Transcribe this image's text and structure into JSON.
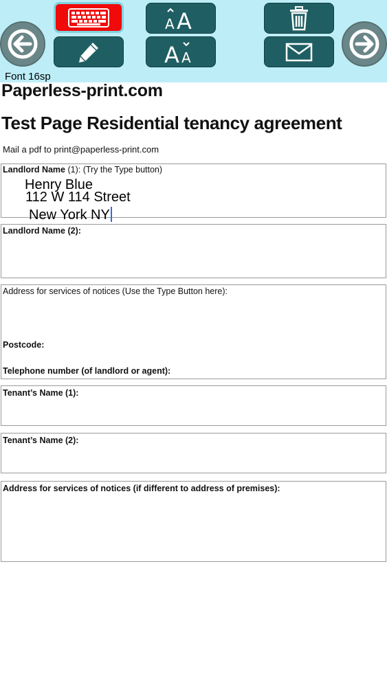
{
  "toolbar": {
    "font_label": "Font 16sp",
    "buttons": {
      "keyboard": "keyboard-icon",
      "font_larger": "ÂA",
      "delete": "trash-icon",
      "pen": "pencil-icon",
      "font_smaller": "AǍ",
      "mail": "envelope-icon"
    },
    "colors": {
      "bar": "#bdeef8",
      "button": "#1f5f63",
      "active_button": "#f00a0a",
      "nav": "#6b8688"
    }
  },
  "document": {
    "site": "Paperless-print.com",
    "heading": "Test Page Residential tenancy agreement",
    "mail_line": "Mail a pdf to print@paperless-print.com",
    "fields": {
      "landlord1_label_bold": "Landlord Name",
      "landlord1_label_rest": " (1): (Try the Type button)",
      "landlord1_typed": [
        "Henry Blue",
        "112 W 114 Street",
        "New York NY"
      ],
      "landlord2_label": "Landlord Name (2):",
      "notices_label": "Address for services of notices (Use the Type Button here):",
      "postcode_label": "Postcode:",
      "telephone_label": "Telephone number (of landlord or agent):",
      "tenant1_label": "Tenant’s Name (1):",
      "tenant2_label": "Tenant’s Name (2):",
      "notices2_label": "Address for services of notices (if different to address of premises):"
    }
  }
}
